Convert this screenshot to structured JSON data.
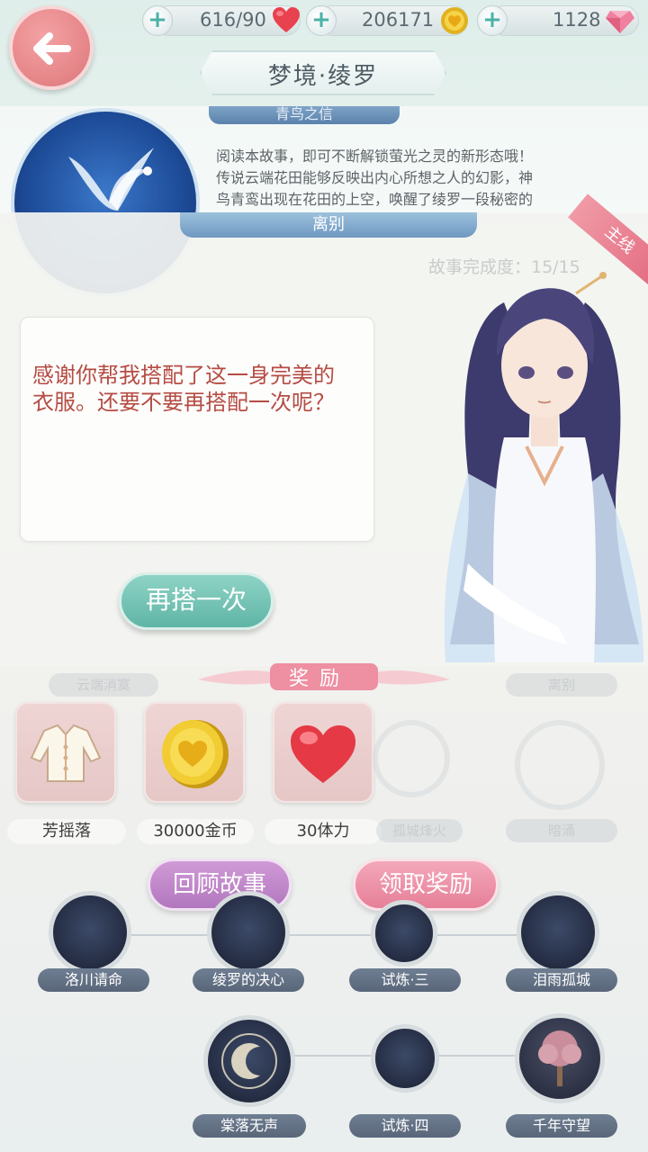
{
  "header": {
    "stamina": "616/90",
    "gold": "206171",
    "diamonds": "1128",
    "title": "梦境·绫罗"
  },
  "story": {
    "tab": "青鸟之信",
    "desc_line1": "阅读本故事，即可不断解锁萤光之灵的新形态哦！",
    "desc_line2": "传说云端花田能够反映出内心所想之人的幻影，神",
    "desc_line3": "鸟青鸾出现在花田的上空，唤醒了绫罗一段秘密的"
  },
  "dialog": {
    "section_title": "离别",
    "ribbon": "主线",
    "progress_text": "故事完成度：15/15",
    "speech_line1": "感谢你帮我搭配了这一身完美的",
    "speech_line2": "衣服。还要不要再搭配一次呢？",
    "again_button": "再搭一次"
  },
  "rewards": {
    "title": "奖励",
    "items": [
      {
        "label": "芳摇落",
        "icon": "jacket-icon"
      },
      {
        "label": "30000金币",
        "icon": "gold-coin-icon"
      },
      {
        "label": "30体力",
        "icon": "heart-icon"
      }
    ],
    "review_button": "回顾故事",
    "claim_button": "领取奖励"
  },
  "background_labels": {
    "row1": [
      "云端消寞",
      "离别"
    ],
    "row2": [
      "孤城烽火",
      "暗涌"
    ]
  },
  "map": {
    "row1": [
      "洛川请命",
      "绫罗的决心",
      "试炼·三",
      "泪雨孤城"
    ],
    "row2": [
      "棠落无声",
      "试炼·四",
      "千年守望"
    ]
  },
  "colors": {
    "accent_teal": "#5fb5a6",
    "accent_pink": "#e67f98",
    "accent_purple": "#b277be",
    "speech_text": "#b54c43"
  }
}
